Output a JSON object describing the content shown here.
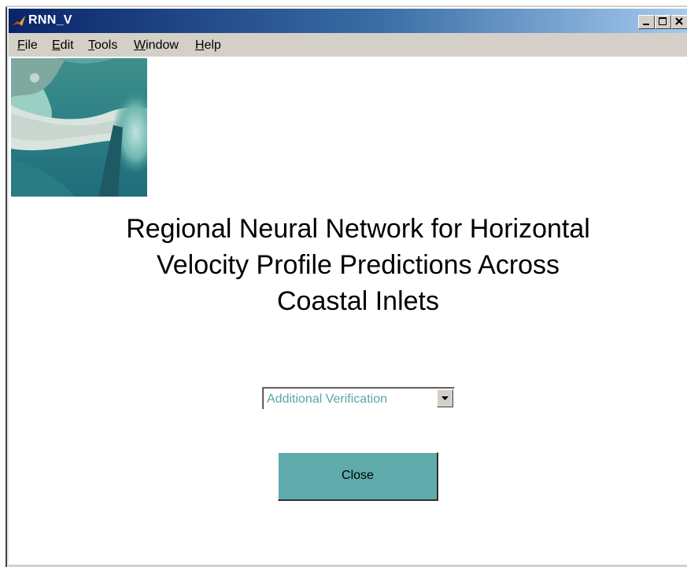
{
  "window": {
    "title": "RNN_V"
  },
  "menu": {
    "items": [
      {
        "label": "File",
        "accel": "F",
        "rest": "ile"
      },
      {
        "label": "Edit",
        "accel": "E",
        "rest": "dit"
      },
      {
        "label": "Tools",
        "accel": "T",
        "rest": "ools"
      },
      {
        "label": "Window",
        "accel": "W",
        "rest": "indow"
      },
      {
        "label": "Help",
        "accel": "H",
        "rest": "elp"
      }
    ]
  },
  "main": {
    "heading_line1": "Regional Neural Network for Horizontal",
    "heading_line2": "Velocity Profile Predictions Across",
    "heading_line3": "Coastal Inlets",
    "dropdown_value": "Additional Verification",
    "close_label": "Close"
  },
  "colors": {
    "accent_teal": "#5faaaa",
    "dropdown_text": "#5aa7a7",
    "titlebar_start": "#0a246a",
    "titlebar_end": "#a6caf0"
  }
}
